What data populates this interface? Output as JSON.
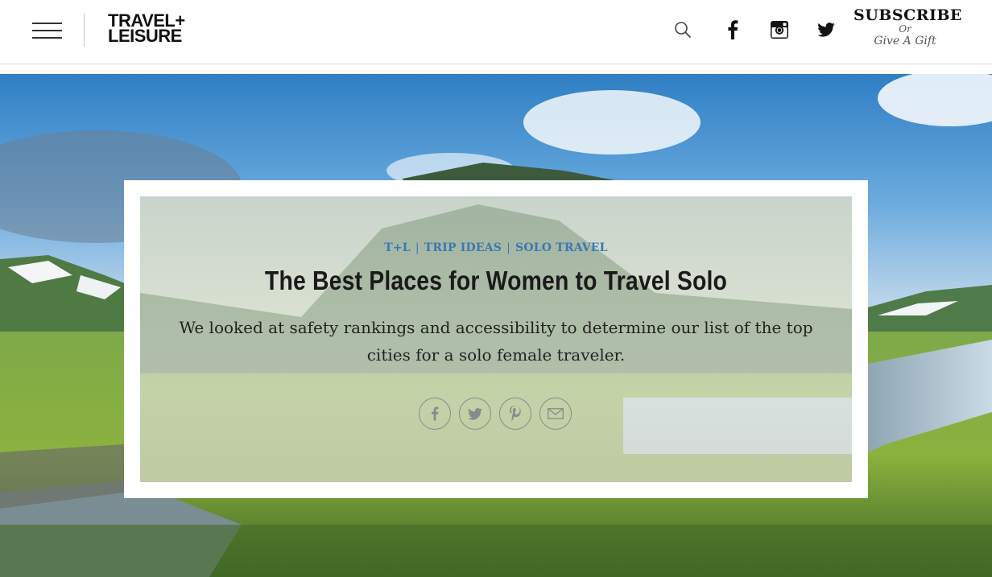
{
  "header": {
    "logo_line1": "TRAVEL+",
    "logo_line2": "LEISURE",
    "icons": [
      "hamburger-menu-icon",
      "search-icon",
      "facebook-icon",
      "instagram-icon",
      "twitter-icon"
    ],
    "subscribe_label": "SUBSCRIBE",
    "or_label": "Or",
    "gift_label": "Give A Gift"
  },
  "article": {
    "breadcrumbs": [
      "T+L",
      "TRIP IDEAS",
      "SOLO TRAVEL"
    ],
    "breadcrumb_separator": "|",
    "title": "The Best Places for Women to Travel Solo",
    "dek": "We looked at safety rankings and accessibility to determine our list of the top cities for a solo female traveler.",
    "share_icons": [
      "facebook-icon",
      "twitter-icon",
      "pinterest-icon",
      "email-icon"
    ]
  },
  "colors": {
    "breadcrumb": "#3a78b5",
    "title": "#1a1a1a",
    "header_text": "#111111"
  }
}
